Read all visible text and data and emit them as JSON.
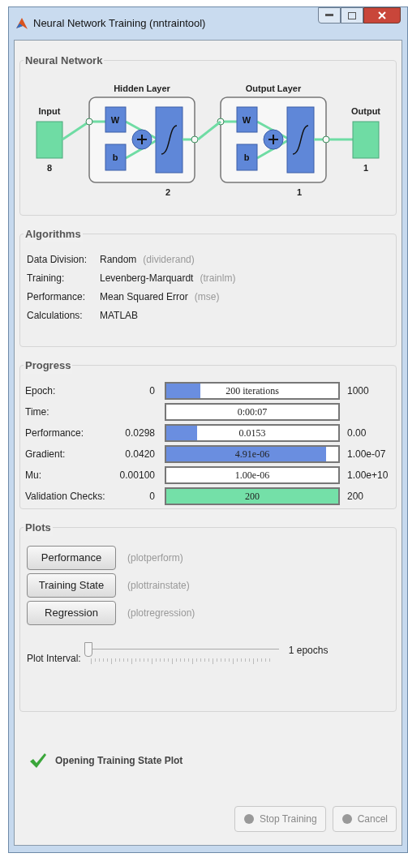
{
  "window": {
    "title": "Neural Network Training (nntraintool)"
  },
  "network": {
    "title": "Neural Network",
    "input": {
      "label": "Input",
      "size": "8"
    },
    "layers": [
      {
        "title": "Hidden Layer",
        "weight": "W",
        "bias": "b",
        "size": "2"
      },
      {
        "title": "Output Layer",
        "weight": "W",
        "bias": "b",
        "size": "1"
      }
    ],
    "output": {
      "label": "Output",
      "size": "1"
    }
  },
  "algorithms": {
    "title": "Algorithms",
    "rows": [
      {
        "label": "Data Division:",
        "value": "Random",
        "function": "(dividerand)"
      },
      {
        "label": "Training:",
        "value": "Levenberg-Marquardt",
        "function": "(trainlm)"
      },
      {
        "label": "Performance:",
        "value": "Mean Squared Error",
        "function": "(mse)"
      },
      {
        "label": "Calculations:",
        "value": "MATLAB"
      }
    ]
  },
  "progress": {
    "title": "Progress",
    "rows": [
      {
        "kind": "bar",
        "label": "Epoch:",
        "start": "0",
        "reading": "200 iterations",
        "end": "1000",
        "level": 0.2,
        "color": "#6a8ee0"
      },
      {
        "kind": "readout",
        "label": "Time:",
        "reading": "0:00:07"
      },
      {
        "kind": "bar",
        "label": "Performance:",
        "start": "0.0298",
        "reading": "0.0153",
        "end": "0.00",
        "level": 0.18,
        "color": "#6a8ee0"
      },
      {
        "kind": "bar",
        "label": "Gradient:",
        "start": "0.0420",
        "reading": "4.91e-06",
        "end": "1.00e-07",
        "level": 0.93,
        "color": "#6a8ee0"
      },
      {
        "kind": "readout",
        "label": "Mu:",
        "start": "0.00100",
        "reading": "1.00e-06",
        "end": "1.00e+10"
      },
      {
        "kind": "bar",
        "label": "Validation Checks:",
        "start": "0",
        "reading": "200",
        "end": "200",
        "level": 1,
        "color": "#74e0a8"
      }
    ]
  },
  "plots": {
    "title": "Plots",
    "buttons": [
      {
        "label": "Performance",
        "function": "(plotperform)"
      },
      {
        "label": "Training State",
        "function": "(plottrainstate)"
      },
      {
        "label": "Regression",
        "function": "(plotregression)"
      }
    ],
    "interval": {
      "label": "Plot Interval:",
      "level": 0,
      "reading": "1 epochs"
    }
  },
  "status": {
    "message": "Opening Training State Plot"
  },
  "buttons": [
    {
      "label": "Stop Training",
      "disabled": true
    },
    {
      "label": "Cancel",
      "disabled": true
    }
  ]
}
